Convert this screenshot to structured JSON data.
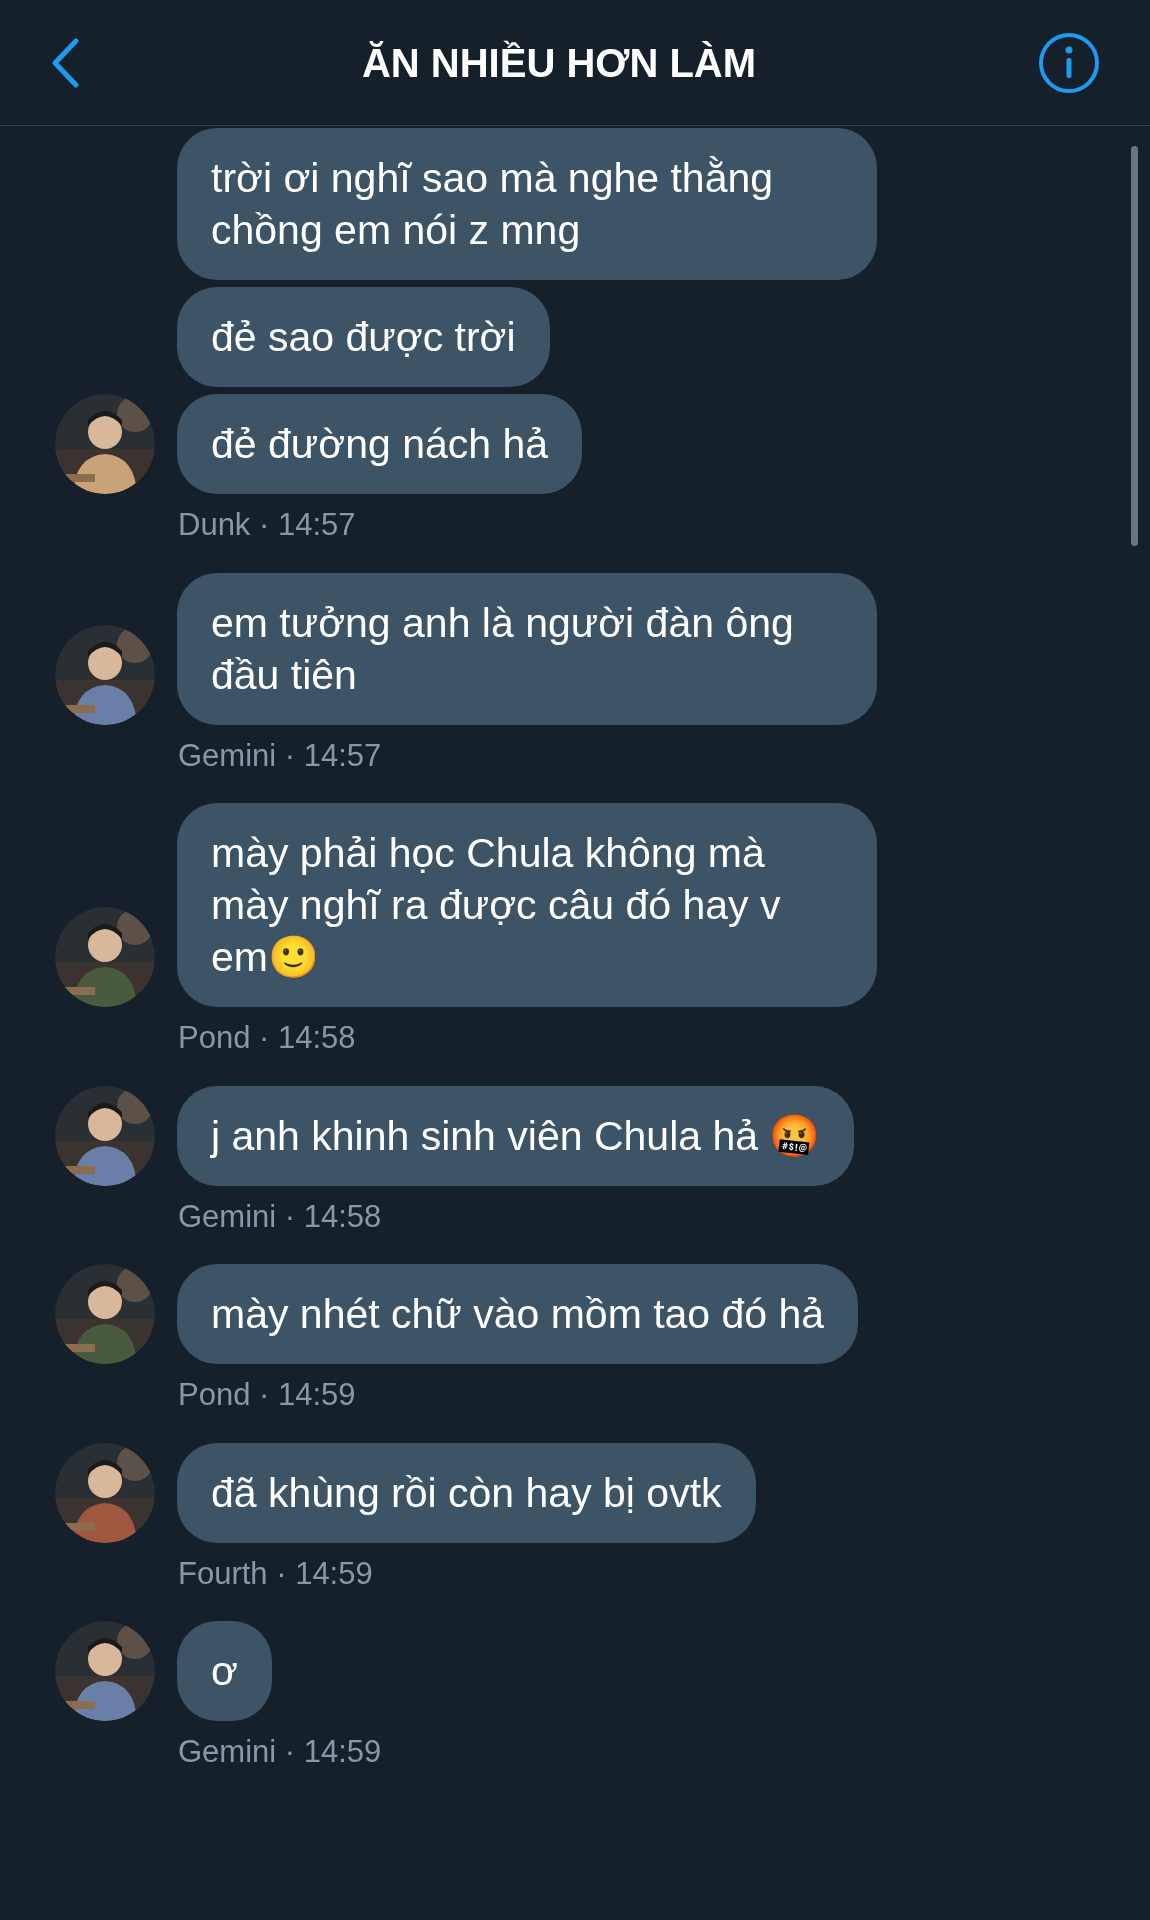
{
  "header": {
    "title": "ĂN NHIỀU HƠN LÀM"
  },
  "groups": [
    {
      "messages": [
        "trời ơi nghĩ sao mà nghe thằng chồng em nói z mng",
        "đẻ sao được trời",
        "đẻ đường nách hả"
      ],
      "meta": "Dunk · 14:57"
    },
    {
      "messages": [
        "em tưởng anh là người đàn ông đầu tiên"
      ],
      "meta": "Gemini · 14:57"
    },
    {
      "messages": [
        "mày phải học Chula không mà mày nghĩ ra được câu đó hay v em🙂"
      ],
      "meta": "Pond · 14:58"
    },
    {
      "messages": [
        "j anh khinh sinh viên Chula hả 🤬"
      ],
      "meta": "Gemini · 14:58"
    },
    {
      "messages": [
        "mày nhét chữ vào mồm tao đó hả"
      ],
      "meta": "Pond · 14:59"
    },
    {
      "messages": [
        "đã khùng rồi còn hay bị ovtk"
      ],
      "meta": "Fourth · 14:59"
    },
    {
      "messages": [
        "ơ"
      ],
      "meta": "Gemini · 14:59"
    }
  ]
}
